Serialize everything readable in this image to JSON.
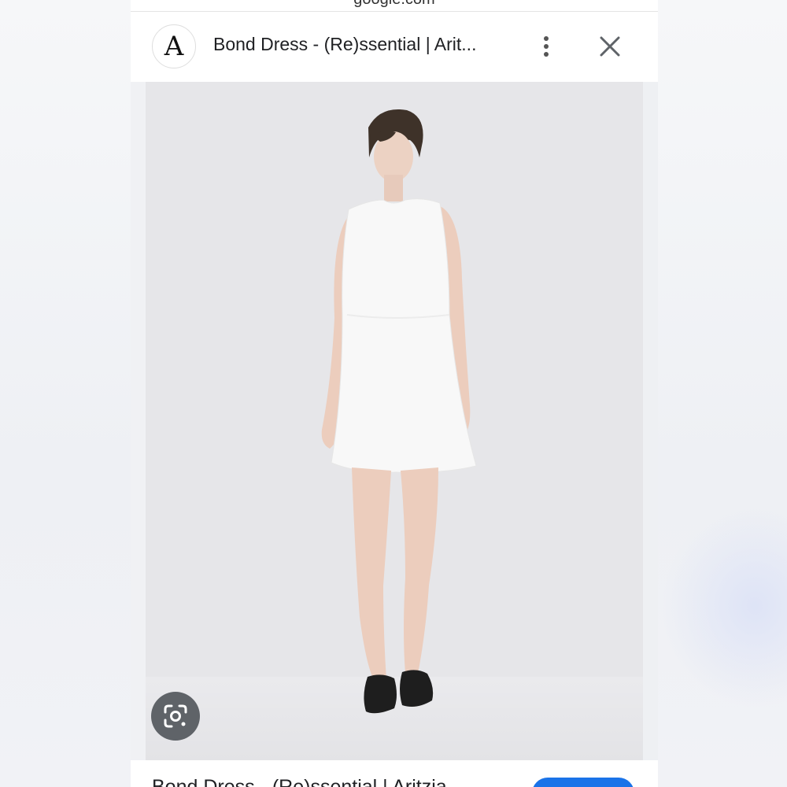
{
  "browser": {
    "url": "google.com"
  },
  "header": {
    "site_logo_letter": "A",
    "title": "Bond Dress - (Re)ssential | Arit...",
    "more_icon": "more-vert-icon",
    "close_icon": "close-icon"
  },
  "image": {
    "lens_icon": "google-lens-icon"
  },
  "bottom": {
    "title": "Bond Dress - (Re)ssential | Aritzia"
  },
  "colors": {
    "accent": "#1a73e8",
    "lens_button": "#5f6368",
    "image_background": "#e6e6e9"
  }
}
